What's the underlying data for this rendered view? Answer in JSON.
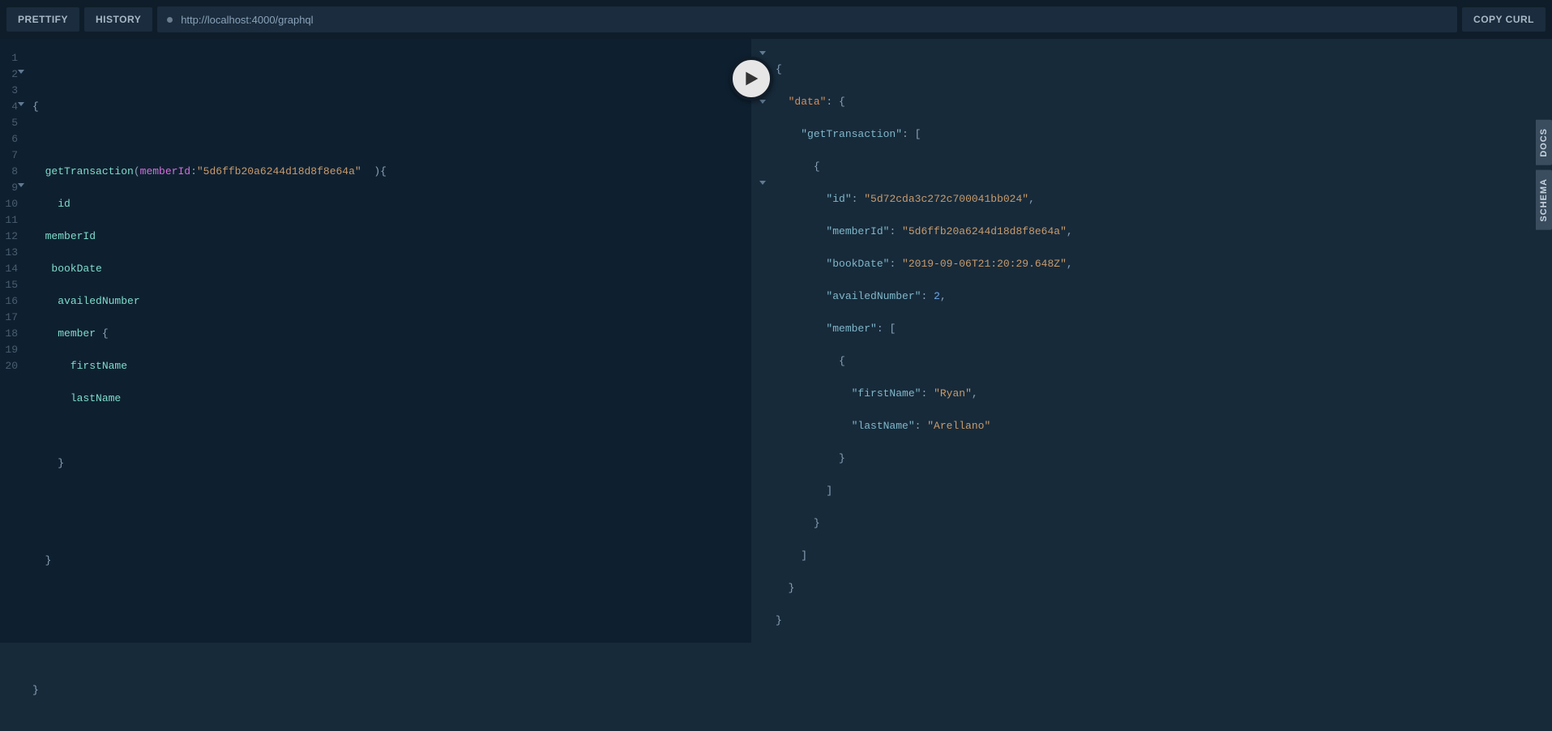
{
  "toolbar": {
    "prettify_label": "PRETTIFY",
    "history_label": "HISTORY",
    "copy_curl_label": "COPY CURL",
    "url": "http://localhost:4000/graphql"
  },
  "side": {
    "docs_label": "DOCS",
    "schema_label": "SCHEMA"
  },
  "editor": {
    "line_numbers": [
      "1",
      "2",
      "3",
      "4",
      "5",
      "6",
      "7",
      "8",
      "9",
      "10",
      "11",
      "12",
      "13",
      "14",
      "15",
      "16",
      "17",
      "18",
      "19",
      "20"
    ],
    "fold_lines": [
      2,
      4,
      9
    ],
    "query": {
      "operation": "getTransaction",
      "open_brace": "{",
      "close_brace": "}",
      "arg_open": "(",
      "arg_close": "  ){",
      "arg_name": "memberId",
      "arg_colon": ":",
      "arg_value": "\"5d6ffb20a6244d18d8f8e64a\"",
      "fields": {
        "id": "id",
        "memberId": "memberId",
        "bookDate": "bookDate",
        "availedNumber": "availedNumber",
        "member": "member",
        "member_open": " {",
        "firstName": "firstName",
        "lastName": "lastName",
        "close1": "}",
        "close2": "}",
        "close3": "}"
      }
    }
  },
  "result": {
    "fold_lines": [
      1,
      2,
      3,
      4,
      9
    ],
    "json": {
      "open": "{",
      "data_key": "\"data\"",
      "colon_brace": ": {",
      "getTransaction_key": "\"getTransaction\"",
      "colon_bracket": ": [",
      "item_open": "{",
      "id_key": "\"id\"",
      "id_val": "\"5d72cda3c272c700041bb024\"",
      "memberId_key": "\"memberId\"",
      "memberId_val": "\"5d6ffb20a6244d18d8f8e64a\"",
      "bookDate_key": "\"bookDate\"",
      "bookDate_val": "\"2019-09-06T21:20:29.648Z\"",
      "availedNumber_key": "\"availedNumber\"",
      "availedNumber_val": "2",
      "member_key": "\"member\"",
      "member_colon_bracket": ": [",
      "member_item_open": "{",
      "firstName_key": "\"firstName\"",
      "firstName_val": "\"Ryan\"",
      "lastName_key": "\"lastName\"",
      "lastName_val": "\"Arellano\"",
      "member_item_close": "}",
      "member_close": "]",
      "item_close": "}",
      "gt_close": "]",
      "data_close": "}",
      "root_close": "}",
      "comma": ","
    }
  }
}
